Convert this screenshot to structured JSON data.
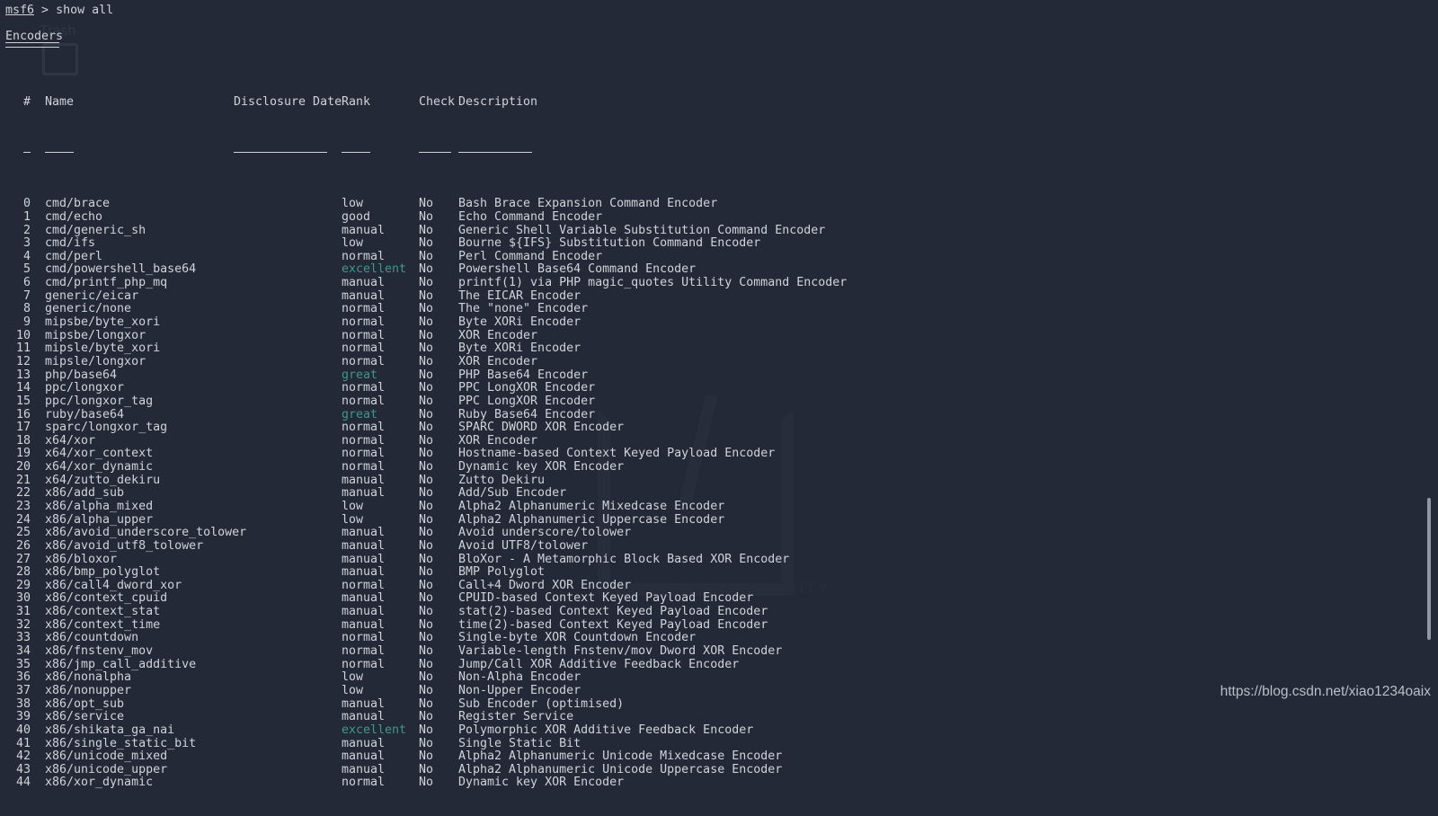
{
  "prompt": {
    "host": "msf6",
    "separator": " > ",
    "command": "show all"
  },
  "section": {
    "title": "Encoders"
  },
  "table": {
    "headers": {
      "num": "#",
      "name": "Name",
      "disclosure_date": "Disclosure Date",
      "rank": "Rank",
      "check": "Check",
      "description": "Description"
    },
    "rows": [
      {
        "num": "0",
        "name": "cmd/brace",
        "date": "",
        "rank": "low",
        "check": "No",
        "desc": "Bash Brace Expansion Command Encoder"
      },
      {
        "num": "1",
        "name": "cmd/echo",
        "date": "",
        "rank": "good",
        "check": "No",
        "desc": "Echo Command Encoder"
      },
      {
        "num": "2",
        "name": "cmd/generic_sh",
        "date": "",
        "rank": "manual",
        "check": "No",
        "desc": "Generic Shell Variable Substitution Command Encoder"
      },
      {
        "num": "3",
        "name": "cmd/ifs",
        "date": "",
        "rank": "low",
        "check": "No",
        "desc": "Bourne ${IFS} Substitution Command Encoder"
      },
      {
        "num": "4",
        "name": "cmd/perl",
        "date": "",
        "rank": "normal",
        "check": "No",
        "desc": "Perl Command Encoder"
      },
      {
        "num": "5",
        "name": "cmd/powershell_base64",
        "date": "",
        "rank": "excellent",
        "check": "No",
        "desc": "Powershell Base64 Command Encoder"
      },
      {
        "num": "6",
        "name": "cmd/printf_php_mq",
        "date": "",
        "rank": "manual",
        "check": "No",
        "desc": "printf(1) via PHP magic_quotes Utility Command Encoder"
      },
      {
        "num": "7",
        "name": "generic/eicar",
        "date": "",
        "rank": "manual",
        "check": "No",
        "desc": "The EICAR Encoder"
      },
      {
        "num": "8",
        "name": "generic/none",
        "date": "",
        "rank": "normal",
        "check": "No",
        "desc": "The \"none\" Encoder"
      },
      {
        "num": "9",
        "name": "mipsbe/byte_xori",
        "date": "",
        "rank": "normal",
        "check": "No",
        "desc": "Byte XORi Encoder"
      },
      {
        "num": "10",
        "name": "mipsbe/longxor",
        "date": "",
        "rank": "normal",
        "check": "No",
        "desc": "XOR Encoder"
      },
      {
        "num": "11",
        "name": "mipsle/byte_xori",
        "date": "",
        "rank": "normal",
        "check": "No",
        "desc": "Byte XORi Encoder"
      },
      {
        "num": "12",
        "name": "mipsle/longxor",
        "date": "",
        "rank": "normal",
        "check": "No",
        "desc": "XOR Encoder"
      },
      {
        "num": "13",
        "name": "php/base64",
        "date": "",
        "rank": "great",
        "check": "No",
        "desc": "PHP Base64 Encoder"
      },
      {
        "num": "14",
        "name": "ppc/longxor",
        "date": "",
        "rank": "normal",
        "check": "No",
        "desc": "PPC LongXOR Encoder"
      },
      {
        "num": "15",
        "name": "ppc/longxor_tag",
        "date": "",
        "rank": "normal",
        "check": "No",
        "desc": "PPC LongXOR Encoder"
      },
      {
        "num": "16",
        "name": "ruby/base64",
        "date": "",
        "rank": "great",
        "check": "No",
        "desc": "Ruby Base64 Encoder"
      },
      {
        "num": "17",
        "name": "sparc/longxor_tag",
        "date": "",
        "rank": "normal",
        "check": "No",
        "desc": "SPARC DWORD XOR Encoder"
      },
      {
        "num": "18",
        "name": "x64/xor",
        "date": "",
        "rank": "normal",
        "check": "No",
        "desc": "XOR Encoder"
      },
      {
        "num": "19",
        "name": "x64/xor_context",
        "date": "",
        "rank": "normal",
        "check": "No",
        "desc": "Hostname-based Context Keyed Payload Encoder"
      },
      {
        "num": "20",
        "name": "x64/xor_dynamic",
        "date": "",
        "rank": "normal",
        "check": "No",
        "desc": "Dynamic key XOR Encoder"
      },
      {
        "num": "21",
        "name": "x64/zutto_dekiru",
        "date": "",
        "rank": "manual",
        "check": "No",
        "desc": "Zutto Dekiru"
      },
      {
        "num": "22",
        "name": "x86/add_sub",
        "date": "",
        "rank": "manual",
        "check": "No",
        "desc": "Add/Sub Encoder"
      },
      {
        "num": "23",
        "name": "x86/alpha_mixed",
        "date": "",
        "rank": "low",
        "check": "No",
        "desc": "Alpha2 Alphanumeric Mixedcase Encoder"
      },
      {
        "num": "24",
        "name": "x86/alpha_upper",
        "date": "",
        "rank": "low",
        "check": "No",
        "desc": "Alpha2 Alphanumeric Uppercase Encoder"
      },
      {
        "num": "25",
        "name": "x86/avoid_underscore_tolower",
        "date": "",
        "rank": "manual",
        "check": "No",
        "desc": "Avoid underscore/tolower"
      },
      {
        "num": "26",
        "name": "x86/avoid_utf8_tolower",
        "date": "",
        "rank": "manual",
        "check": "No",
        "desc": "Avoid UTF8/tolower"
      },
      {
        "num": "27",
        "name": "x86/bloxor",
        "date": "",
        "rank": "manual",
        "check": "No",
        "desc": "BloXor - A Metamorphic Block Based XOR Encoder"
      },
      {
        "num": "28",
        "name": "x86/bmp_polyglot",
        "date": "",
        "rank": "manual",
        "check": "No",
        "desc": "BMP Polyglot"
      },
      {
        "num": "29",
        "name": "x86/call4_dword_xor",
        "date": "",
        "rank": "normal",
        "check": "No",
        "desc": "Call+4 Dword XOR Encoder"
      },
      {
        "num": "30",
        "name": "x86/context_cpuid",
        "date": "",
        "rank": "manual",
        "check": "No",
        "desc": "CPUID-based Context Keyed Payload Encoder"
      },
      {
        "num": "31",
        "name": "x86/context_stat",
        "date": "",
        "rank": "manual",
        "check": "No",
        "desc": "stat(2)-based Context Keyed Payload Encoder"
      },
      {
        "num": "32",
        "name": "x86/context_time",
        "date": "",
        "rank": "manual",
        "check": "No",
        "desc": "time(2)-based Context Keyed Payload Encoder"
      },
      {
        "num": "33",
        "name": "x86/countdown",
        "date": "",
        "rank": "normal",
        "check": "No",
        "desc": "Single-byte XOR Countdown Encoder"
      },
      {
        "num": "34",
        "name": "x86/fnstenv_mov",
        "date": "",
        "rank": "normal",
        "check": "No",
        "desc": "Variable-length Fnstenv/mov Dword XOR Encoder"
      },
      {
        "num": "35",
        "name": "x86/jmp_call_additive",
        "date": "",
        "rank": "normal",
        "check": "No",
        "desc": "Jump/Call XOR Additive Feedback Encoder"
      },
      {
        "num": "36",
        "name": "x86/nonalpha",
        "date": "",
        "rank": "low",
        "check": "No",
        "desc": "Non-Alpha Encoder"
      },
      {
        "num": "37",
        "name": "x86/nonupper",
        "date": "",
        "rank": "low",
        "check": "No",
        "desc": "Non-Upper Encoder"
      },
      {
        "num": "38",
        "name": "x86/opt_sub",
        "date": "",
        "rank": "manual",
        "check": "No",
        "desc": "Sub Encoder (optimised)"
      },
      {
        "num": "39",
        "name": "x86/service",
        "date": "",
        "rank": "manual",
        "check": "No",
        "desc": "Register Service"
      },
      {
        "num": "40",
        "name": "x86/shikata_ga_nai",
        "date": "",
        "rank": "excellent",
        "check": "No",
        "desc": "Polymorphic XOR Additive Feedback Encoder"
      },
      {
        "num": "41",
        "name": "x86/single_static_bit",
        "date": "",
        "rank": "manual",
        "check": "No",
        "desc": "Single Static Bit"
      },
      {
        "num": "42",
        "name": "x86/unicode_mixed",
        "date": "",
        "rank": "manual",
        "check": "No",
        "desc": "Alpha2 Alphanumeric Unicode Mixedcase Encoder"
      },
      {
        "num": "43",
        "name": "x86/unicode_upper",
        "date": "",
        "rank": "manual",
        "check": "No",
        "desc": "Alpha2 Alphanumeric Unicode Uppercase Encoder"
      },
      {
        "num": "44",
        "name": "x86/xor_dynamic",
        "date": "",
        "rank": "normal",
        "check": "No",
        "desc": "Dynamic key XOR Encoder"
      }
    ]
  },
  "watermarks": {
    "url": "https://blog.csdn.net/xiao1234oaix",
    "desktop_subtitle": "BY OFFENSIVE SECURITY",
    "trash_label": "Trash"
  },
  "colors": {
    "background": "#232936",
    "text": "#cfd4d9",
    "rank_highlight": "#43958a"
  }
}
